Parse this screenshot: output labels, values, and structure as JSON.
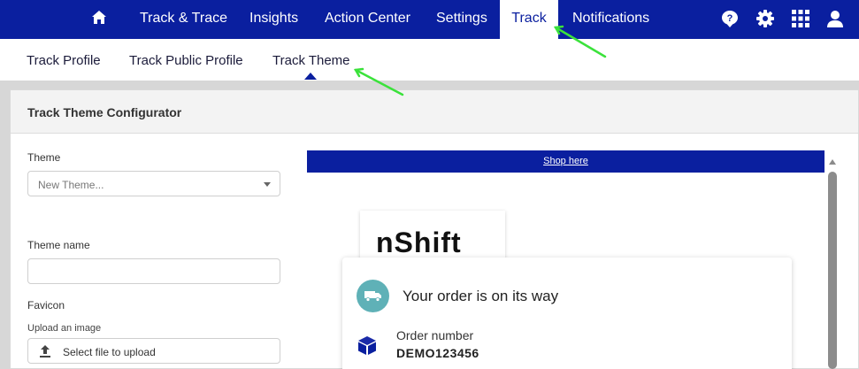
{
  "topnav": {
    "items": [
      "Track & Trace",
      "Insights",
      "Action Center",
      "Settings",
      "Track",
      "Notifications"
    ],
    "active": "Track",
    "icons": [
      "home-icon",
      "help-icon",
      "gear-icon",
      "apps-grid-icon",
      "user-icon"
    ]
  },
  "subnav": {
    "items": [
      "Track Profile",
      "Track Public Profile",
      "Track Theme"
    ],
    "active": "Track Theme"
  },
  "panel": {
    "title": "Track Theme Configurator",
    "theme_label": "Theme",
    "theme_select_value": "New Theme...",
    "theme_name_label": "Theme name",
    "theme_name_value": "",
    "favicon_label": "Favicon",
    "upload_hint": "Upload an image",
    "upload_button": "Select file to upload"
  },
  "preview": {
    "banner_link": "Shop here",
    "logo_text": "nShift",
    "card_title": "Your order is on its way",
    "order_label": "Order number",
    "order_value": "DEMO123456"
  },
  "colors": {
    "brand_navy": "#0a1f9f",
    "teal": "#5fb1b7",
    "annotation_arrow": "#3be23b"
  }
}
